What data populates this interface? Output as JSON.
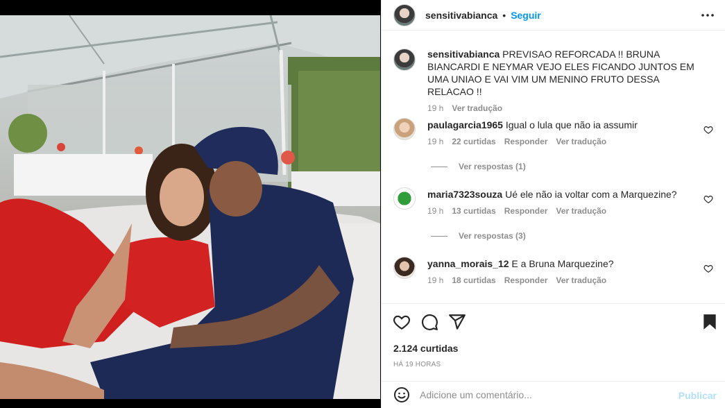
{
  "post": {
    "username": "sensitivabianca",
    "follow_label": "Seguir",
    "separator": "•",
    "caption": {
      "username": "sensitivabianca",
      "text": "PREVISAO REFORCADA !! BRUNA BIANCARDI E NEYMAR VEJO ELES FICANDO JUNTOS EM UMA UNIAO E VAI VIM UM MENINO FRUTO DESSA RELACAO !!",
      "time": "19 h",
      "translate": "Ver tradução"
    },
    "comments": [
      {
        "username": "paulagarcia1965",
        "text": "Igual o lula que não ia assumir",
        "time": "19 h",
        "likes": "22 curtidas",
        "reply": "Responder",
        "translate": "Ver tradução",
        "view_replies": "Ver respostas (1)"
      },
      {
        "username": "maria7323souza",
        "text": "Ué ele não ia voltar com a Marquezine?",
        "time": "19 h",
        "likes": "13 curtidas",
        "reply": "Responder",
        "translate": "Ver tradução",
        "view_replies": "Ver respostas (3)"
      },
      {
        "username": "yanna_morais_12",
        "text": "E a Bruna Marquezine?",
        "time": "19 h",
        "likes": "18 curtidas",
        "reply": "Responder",
        "translate": "Ver tradução"
      }
    ],
    "likes_count": "2.124 curtidas",
    "posted_ago": "HÁ 19 HORAS",
    "add_comment_placeholder": "Adicione um comentário...",
    "publish_label": "Publicar"
  },
  "icons": {
    "more": "more-options-icon",
    "like": "heart-icon",
    "comment": "comment-icon",
    "share": "share-icon",
    "save": "bookmark-icon",
    "emoji": "emoji-icon"
  },
  "colors": {
    "accent": "#0095f6",
    "publish_disabled": "#b2dffc",
    "muted": "#8e8e8e",
    "text": "#262626"
  }
}
